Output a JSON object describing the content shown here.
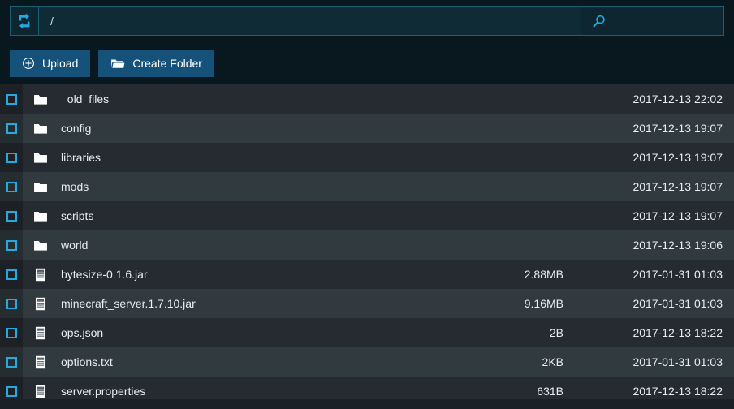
{
  "topbar": {
    "refresh_icon": "refresh-icon",
    "path_value": "/",
    "path_placeholder": "/",
    "search_icon": "search-icon",
    "search_value": "",
    "search_placeholder": ""
  },
  "actions": {
    "upload_label": "Upload",
    "upload_icon": "plus-circle-icon",
    "create_folder_label": "Create Folder",
    "create_folder_icon": "folder-open-icon"
  },
  "colors": {
    "accent_blue": "#29a8e0",
    "button_blue": "#155179",
    "header_bg": "#08181e",
    "row_dark": "#262b31",
    "row_light": "#313a3f",
    "border_teal": "#1d5e73"
  },
  "files": [
    {
      "name": "_old_files",
      "type": "folder",
      "icon": "folder-icon",
      "size": "",
      "date": "2017-12-13 22:02"
    },
    {
      "name": "config",
      "type": "folder",
      "icon": "folder-icon",
      "size": "",
      "date": "2017-12-13 19:07"
    },
    {
      "name": "libraries",
      "type": "folder",
      "icon": "folder-icon",
      "size": "",
      "date": "2017-12-13 19:07"
    },
    {
      "name": "mods",
      "type": "folder",
      "icon": "folder-icon",
      "size": "",
      "date": "2017-12-13 19:07"
    },
    {
      "name": "scripts",
      "type": "folder",
      "icon": "folder-icon",
      "size": "",
      "date": "2017-12-13 19:07"
    },
    {
      "name": "world",
      "type": "folder",
      "icon": "folder-icon",
      "size": "",
      "date": "2017-12-13 19:06"
    },
    {
      "name": "bytesize-0.1.6.jar",
      "type": "file",
      "icon": "file-icon",
      "size": "2.88MB",
      "date": "2017-01-31 01:03"
    },
    {
      "name": "minecraft_server.1.7.10.jar",
      "type": "file",
      "icon": "file-icon",
      "size": "9.16MB",
      "date": "2017-01-31 01:03"
    },
    {
      "name": "ops.json",
      "type": "file",
      "icon": "file-icon",
      "size": "2B",
      "date": "2017-12-13 18:22"
    },
    {
      "name": "options.txt",
      "type": "file",
      "icon": "file-icon",
      "size": "2KB",
      "date": "2017-01-31 01:03"
    },
    {
      "name": "server.properties",
      "type": "file",
      "icon": "file-icon",
      "size": "631B",
      "date": "2017-12-13 18:22"
    }
  ]
}
